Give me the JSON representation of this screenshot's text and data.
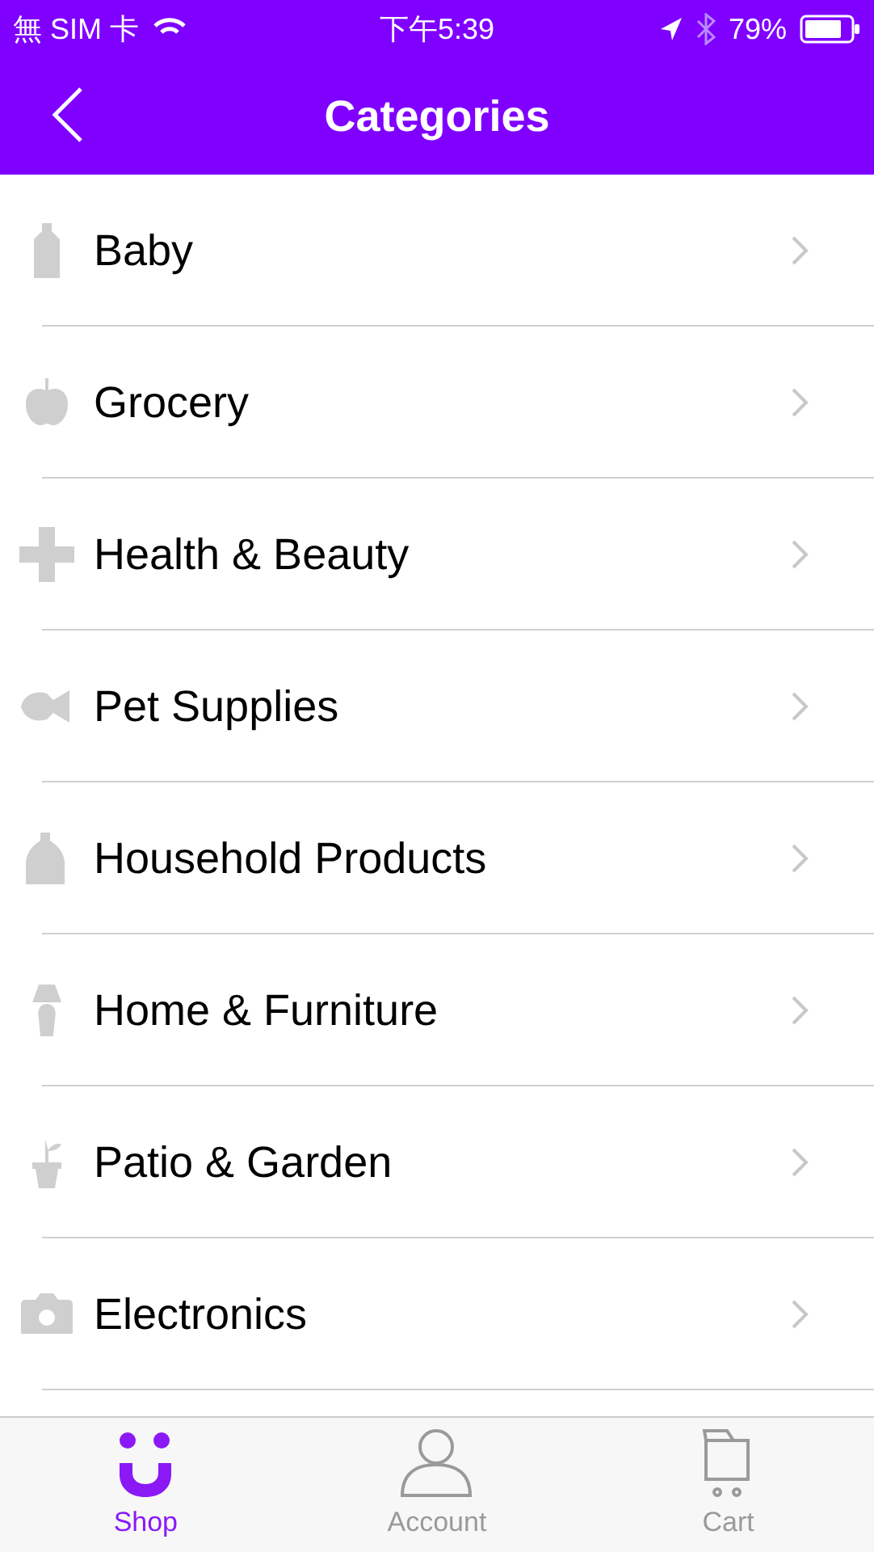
{
  "status_bar": {
    "carrier": "無 SIM 卡",
    "time": "下午5:39",
    "battery": "79%"
  },
  "nav": {
    "title": "Categories"
  },
  "categories": [
    {
      "label": "Baby",
      "kind": "bottle"
    },
    {
      "label": "Grocery",
      "kind": "apple"
    },
    {
      "label": "Health & Beauty",
      "kind": "cross"
    },
    {
      "label": "Pet Supplies",
      "kind": "fish"
    },
    {
      "label": "Household Products",
      "kind": "jug"
    },
    {
      "label": "Home & Furniture",
      "kind": "lamp"
    },
    {
      "label": "Patio & Garden",
      "kind": "plant"
    },
    {
      "label": "Electronics",
      "kind": "camera"
    }
  ],
  "tabs": [
    {
      "label": "Shop",
      "kind": "shop",
      "selected": true
    },
    {
      "label": "Account",
      "kind": "account",
      "selected": false
    },
    {
      "label": "Cart",
      "kind": "cart",
      "selected": false
    }
  ]
}
